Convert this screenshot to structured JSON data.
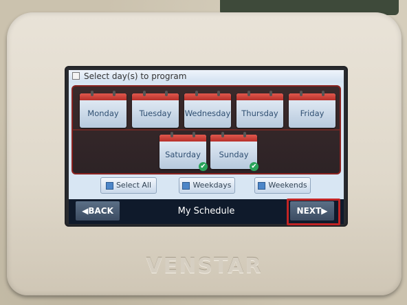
{
  "screen": {
    "title": "Select day(s) to program",
    "days_row1": [
      "Monday",
      "Tuesday",
      "Wednesday",
      "Thursday",
      "Friday"
    ],
    "days_row2": [
      {
        "label": "Saturday",
        "selected": true
      },
      {
        "label": "Sunday",
        "selected": true
      }
    ],
    "buttons": [
      "Select All",
      "Weekdays",
      "Weekends"
    ],
    "nav": {
      "back": "◀BACK",
      "title": "My Schedule",
      "next": "NEXT▶"
    },
    "check_glyph": "✔"
  },
  "device": {
    "brand": "VENSTAR"
  },
  "colors": {
    "highlight": "#c22424",
    "panel_border": "#8b2320",
    "navbar": "#0f1a2b"
  }
}
